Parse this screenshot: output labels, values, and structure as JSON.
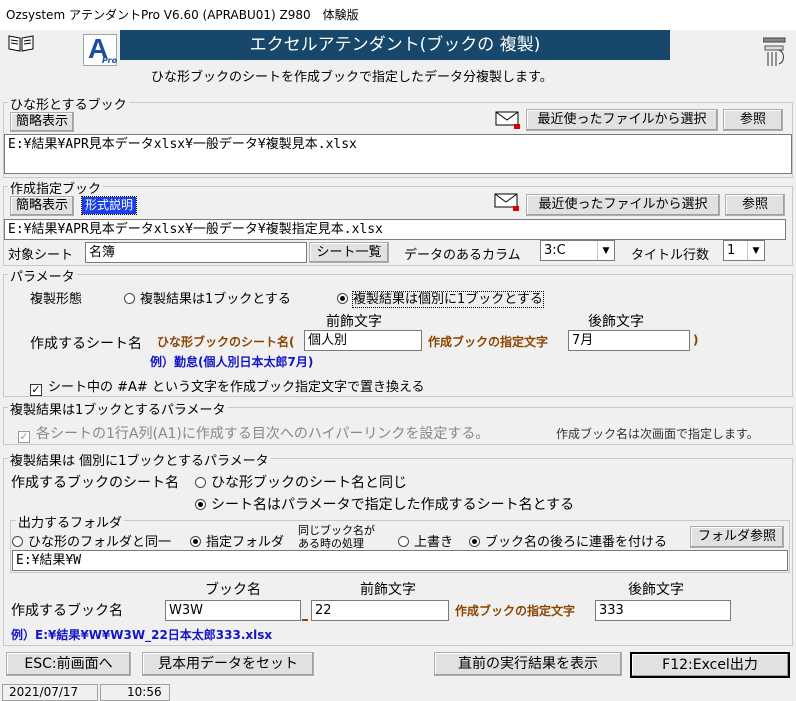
{
  "window": {
    "title": "Ozsystem アテンダントPro V6.60 (APRABU01) Z980　体験版"
  },
  "header": {
    "title": "エクセルアテンダント(ブックの 複製)",
    "subtitle": "ひな形ブックのシートを作成ブックで指定したデータ分複製します。",
    "logo_letter": "A",
    "logo_sub": "Pro"
  },
  "template_book": {
    "group_label": "ひな形とするブック",
    "short_display": "簡略表示",
    "recent_button": "最近使ったファイルから選択",
    "browse_button": "参照",
    "path": "E:¥結果¥APR見本データxlsx¥一般データ¥複製見本.xlsx"
  },
  "spec_book": {
    "group_label": "作成指定ブック",
    "short_display": "簡略表示",
    "format_button": "形式説明",
    "recent_button": "最近使ったファイルから選択",
    "browse_button": "参照",
    "path": "E:¥結果¥APR見本データxlsx¥一般データ¥複製指定見本.xlsx",
    "target_sheet_label": "対象シート",
    "target_sheet_value": "名簿",
    "sheet_list_button": "シート一覧",
    "data_column_label": "データのあるカラム",
    "data_column_value": "3:C",
    "title_rows_label": "タイトル行数",
    "title_rows_value": "1"
  },
  "params": {
    "group_label": "パラメータ",
    "dup_mode_label": "複製形態",
    "radio_one_book": "複製結果は1ブックとする",
    "radio_each_book": "複製結果は個別に1ブックとする",
    "prefix_header": "前飾文字",
    "suffix_header": "後飾文字",
    "sheet_name_label": "作成するシート名",
    "template_sheet_name": "ひな形ブックのシート名(",
    "prefix_value": "個人別",
    "spec_text": "作成ブックの指定文字",
    "suffix_value": "7月",
    "close_paren": ")",
    "example": "例）勤怠(個人別日本太郎7月)",
    "replace_check": "シート中の #A# という文字を作成ブック指定文字で置き換える"
  },
  "one_book_params": {
    "group_label": "複製結果は1ブックとするパラメータ",
    "hyperlink_check": "各シートの1行A列(A1)に作成する目次へのハイパーリンクを設定する。",
    "note": "作成ブック名は次画面で指定します。"
  },
  "each_book_params": {
    "group_label": "複製結果は 個別に1ブックとするパラメータ",
    "book_sheet_label": "作成するブックのシート名",
    "radio_same": "ひな形ブックのシート名と同じ",
    "radio_param": "シート名はパラメータで指定した作成するシート名とする",
    "output_folder_label": "出力するフォルダ",
    "radio_same_folder": "ひな形のフォルダと同一",
    "radio_spec_folder": "指定フォルダ",
    "same_name_label_1": "同じブック名が",
    "same_name_label_2": "ある時の処理",
    "radio_overwrite": "上書き",
    "radio_serial": "ブック名の後ろに連番を付ける",
    "folder_browse_button": "フォルダ参照",
    "folder_path": "E:¥結果¥W",
    "book_name_header": "ブック名",
    "prefix_header": "前飾文字",
    "suffix_header": "後飾文字",
    "create_book_label": "作成するブック名",
    "book_name_value": "W3W",
    "prefix_value": "22",
    "spec_text": "作成ブックの指定文字",
    "suffix_value": "333",
    "example": "例）E:¥結果¥W¥W3W_22日本太郎333.xlsx"
  },
  "footer": {
    "esc_button": "ESC:前画面へ",
    "sample_button": "見本用データをセット",
    "last_result_button": "直前の実行結果を表示",
    "run_button": "F12:Excel出力"
  },
  "statusbar": {
    "date": "2021/07/17",
    "time": "10:56"
  },
  "colors": {
    "header_bg": "#17476a",
    "header_text": "#ffffff",
    "brown": "#8b4500",
    "blue": "#1515c8",
    "logo_blue": "#1a4fa0"
  }
}
